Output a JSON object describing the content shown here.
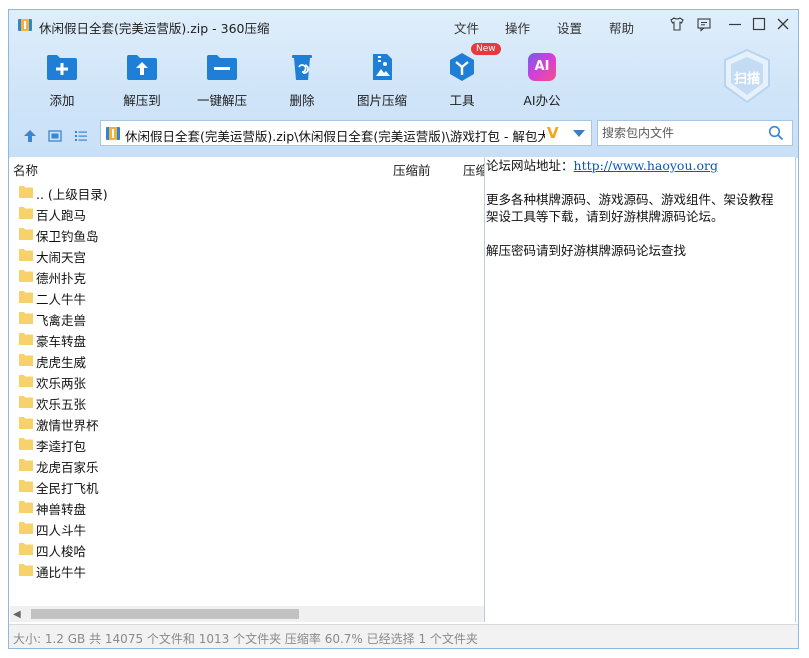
{
  "window": {
    "title": "休闲假日全套(完美运营版).zip - 360压缩"
  },
  "menu": [
    "文件",
    "操作",
    "设置",
    "帮助"
  ],
  "toolbar": {
    "buttons": [
      {
        "label": "添加",
        "icon": "add-folder-icon"
      },
      {
        "label": "解压到",
        "icon": "extract-to-icon"
      },
      {
        "label": "一键解压",
        "icon": "one-click-extract-icon"
      },
      {
        "label": "删除",
        "icon": "recycle-bin-icon"
      },
      {
        "label": "图片压缩",
        "icon": "image-compress-icon"
      },
      {
        "label": "工具",
        "icon": "tools-icon"
      },
      {
        "label": "AI办公",
        "icon": "ai-icon"
      }
    ],
    "new_badge": "New",
    "ai_glyph": "AI",
    "scan_label": "扫描"
  },
  "address": {
    "path": "休闲假日全套(完美运营版).zip\\休闲假日全套(完美运营版)\\游戏打包 - 解包大小",
    "vip_mark": "V"
  },
  "search": {
    "placeholder": "搜索包内文件"
  },
  "columns": {
    "name": "名称",
    "before": "压缩前",
    "after": "压缩"
  },
  "files": [
    {
      "name": ".. (上级目录)"
    },
    {
      "name": "百人跑马"
    },
    {
      "name": "保卫钓鱼岛"
    },
    {
      "name": "大闹天宫"
    },
    {
      "name": "德州扑克"
    },
    {
      "name": "二人牛牛"
    },
    {
      "name": "飞禽走兽"
    },
    {
      "name": "豪车转盘"
    },
    {
      "name": "虎虎生威"
    },
    {
      "name": "欢乐两张"
    },
    {
      "name": "欢乐五张"
    },
    {
      "name": "激情世界杯"
    },
    {
      "name": "李逵打包"
    },
    {
      "name": "龙虎百家乐"
    },
    {
      "name": "全民打飞机"
    },
    {
      "name": "神兽转盘"
    },
    {
      "name": "四人斗牛"
    },
    {
      "name": "四人梭哈"
    },
    {
      "name": "通比牛牛"
    }
  ],
  "comment": {
    "forum_label": "论坛网站地址：",
    "forum_url": "http://www.haoyou.org",
    "line2": "更多各种棋牌源码、游戏源码、游戏组件、架设教程",
    "line3": "架设工具等下载，请到好游棋牌源码论坛。",
    "line4": "解压密码请到好游棋牌源码论坛查找"
  },
  "status": {
    "text": "大小: 1.2 GB 共 14075 个文件和 1013 个文件夹 压缩率 60.7% 已经选择 1 个文件夹"
  },
  "colors": {
    "accent": "#1f7fd6",
    "header_bg": "#d3e6f8",
    "folder": "#f7d26a",
    "new_badge": "#e8383d",
    "vip": "#f4a61b"
  }
}
